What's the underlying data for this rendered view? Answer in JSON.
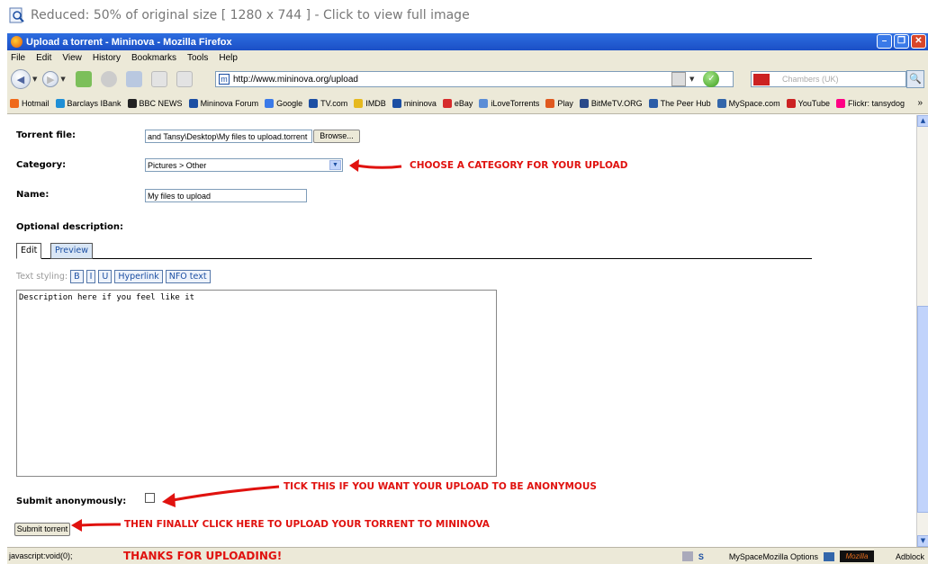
{
  "caption": {
    "text": "Reduced: 50% of original size [ 1280 x 744 ] - Click to view full image"
  },
  "window": {
    "title": "Upload a torrent - Mininova - Mozilla Firefox"
  },
  "menu": [
    "File",
    "Edit",
    "View",
    "History",
    "Bookmarks",
    "Tools",
    "Help"
  ],
  "nav": {
    "url": "http://www.mininova.org/upload",
    "search_placeholder": "Chambers (UK)"
  },
  "bookmarks": [
    {
      "label": "Hotmail",
      "color": "#f06a1a"
    },
    {
      "label": "Barclays IBank",
      "color": "#1f8fd6"
    },
    {
      "label": "BBC NEWS",
      "color": "#222222"
    },
    {
      "label": "Mininova Forum",
      "color": "#1c4fa3"
    },
    {
      "label": "Google",
      "color": "#3b7ae8"
    },
    {
      "label": "TV.com",
      "color": "#1c4fa3"
    },
    {
      "label": "IMDB",
      "color": "#e6b91e"
    },
    {
      "label": "mininova",
      "color": "#1c4fa3"
    },
    {
      "label": "eBay",
      "color": "#d62b2b"
    },
    {
      "label": "iLoveTorrents",
      "color": "#5b8dd6"
    },
    {
      "label": "Play",
      "color": "#e0591f"
    },
    {
      "label": "BitMeTV.ORG",
      "color": "#2a4a8a"
    },
    {
      "label": "The Peer Hub",
      "color": "#2b5da8"
    },
    {
      "label": "MySpace.com",
      "color": "#3366aa"
    },
    {
      "label": "YouTube",
      "color": "#cc2222"
    },
    {
      "label": "Flickr: tansydog",
      "color": "#ff0084"
    }
  ],
  "form": {
    "torrent_label": "Torrent file:",
    "torrent_value": "and Tansy\\Desktop\\My files to upload.torrent",
    "browse_label": "Browse...",
    "category_label": "Category:",
    "category_value": "Pictures > Other",
    "name_label": "Name:",
    "name_value": "My files to upload",
    "desc_label": "Optional description:",
    "tab_edit": "Edit",
    "tab_preview": "Preview",
    "styling_label": "Text styling:",
    "styling_buttons": [
      "B",
      "I",
      "U",
      "Hyperlink",
      "NFO text"
    ],
    "description_text": "Description here if you feel like it",
    "anon_label": "Submit anonymously:",
    "submit_label": "Submit torrent"
  },
  "annotations": {
    "category": "CHOOSE A CATEGORY FOR YOUR UPLOAD",
    "anonymous": "TICK THIS IF YOU WANT YOUR UPLOAD TO BE ANONYMOUS",
    "submit": "THEN FINALLY CLICK HERE TO UPLOAD YOUR TORRENT TO MININOVA",
    "thanks": "THANKS FOR UPLOADING!"
  },
  "status": {
    "left": "javascript:void(0);",
    "myspace_options": "MySpaceMozilla Options",
    "adblock": "Adblock"
  }
}
